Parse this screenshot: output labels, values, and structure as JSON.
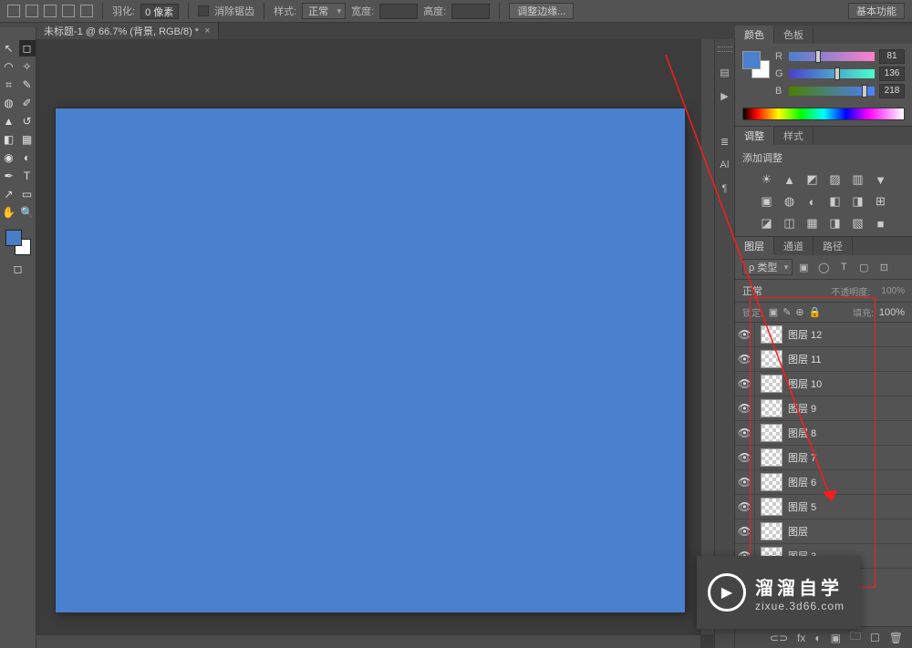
{
  "options_bar": {
    "feather_label": "羽化:",
    "feather_value": "0 像素",
    "antialias_label": "消除锯齿",
    "style_label": "样式:",
    "style_value": "正常",
    "width_label": "宽度:",
    "height_label": "高度:",
    "refine_edge": "调整边缘...",
    "workspace": "基本功能"
  },
  "tabs": [
    {
      "title": "未标题-1 @ 66.7% (背景, RGB/8) *"
    }
  ],
  "tools": [
    [
      "move",
      "marquee"
    ],
    [
      "lasso",
      "wand"
    ],
    [
      "crop",
      "eyedropper"
    ],
    [
      "healing",
      "brush"
    ],
    [
      "stamp",
      "history"
    ],
    [
      "eraser",
      "gradient"
    ],
    [
      "blur",
      "dodge"
    ],
    [
      "pen",
      "type"
    ],
    [
      "path",
      "rectangle"
    ],
    [
      "hand",
      "zoom"
    ]
  ],
  "icon_strip": [
    "history",
    "brushes",
    "char",
    "para",
    "nav",
    "info"
  ],
  "color_panel": {
    "tabs": [
      "颜色",
      "色板"
    ],
    "channels": [
      {
        "label": "R",
        "value": "81",
        "pos": 31
      },
      {
        "label": "G",
        "value": "136",
        "pos": 53
      },
      {
        "label": "B",
        "value": "218",
        "pos": 85
      }
    ]
  },
  "adjust_panel": {
    "tabs": [
      "调整",
      "样式"
    ],
    "label": "添加调整",
    "rows": [
      [
        "☀",
        "▲",
        "◩",
        "▨",
        "▥",
        "▼"
      ],
      [
        "▣",
        "◍",
        "◐",
        "◧",
        "◨",
        "⊞"
      ],
      [
        "◪",
        "◫",
        "▦",
        "◨",
        "▧",
        "■"
      ]
    ]
  },
  "layers_panel": {
    "tabs": [
      "图层",
      "通道",
      "路径"
    ],
    "filter": {
      "label": "ρ 类型"
    },
    "filter_icons": [
      "▣",
      "◯",
      "T",
      "▢",
      "⊡"
    ],
    "blend_mode_label": "正常",
    "opacity_label": "不透明度:",
    "opacity_value": "100%",
    "lock_label": "锁定:",
    "lock_icons": [
      "▣",
      "✎",
      "⊕",
      "🔒"
    ],
    "fill_label": "填充:",
    "fill_value": "100%",
    "layers": [
      {
        "name": "图层 12"
      },
      {
        "name": "图层 11"
      },
      {
        "name": "图层 10"
      },
      {
        "name": "图层 9"
      },
      {
        "name": "图层 8"
      },
      {
        "name": "图层 7"
      },
      {
        "name": "图层 6"
      },
      {
        "name": "图层 5"
      },
      {
        "name": "图层"
      },
      {
        "name": "图层 3"
      }
    ],
    "buttons": [
      "⊂⊃",
      "fx",
      "◐",
      "▣",
      "🗀",
      "☐",
      "🗑"
    ]
  },
  "watermark": {
    "zh": "溜溜自学",
    "url": "zixue.3d66.com"
  },
  "colors": {
    "canvas": "#4a80cd",
    "fg": "#4a80cd",
    "bg": "#ffffff"
  }
}
